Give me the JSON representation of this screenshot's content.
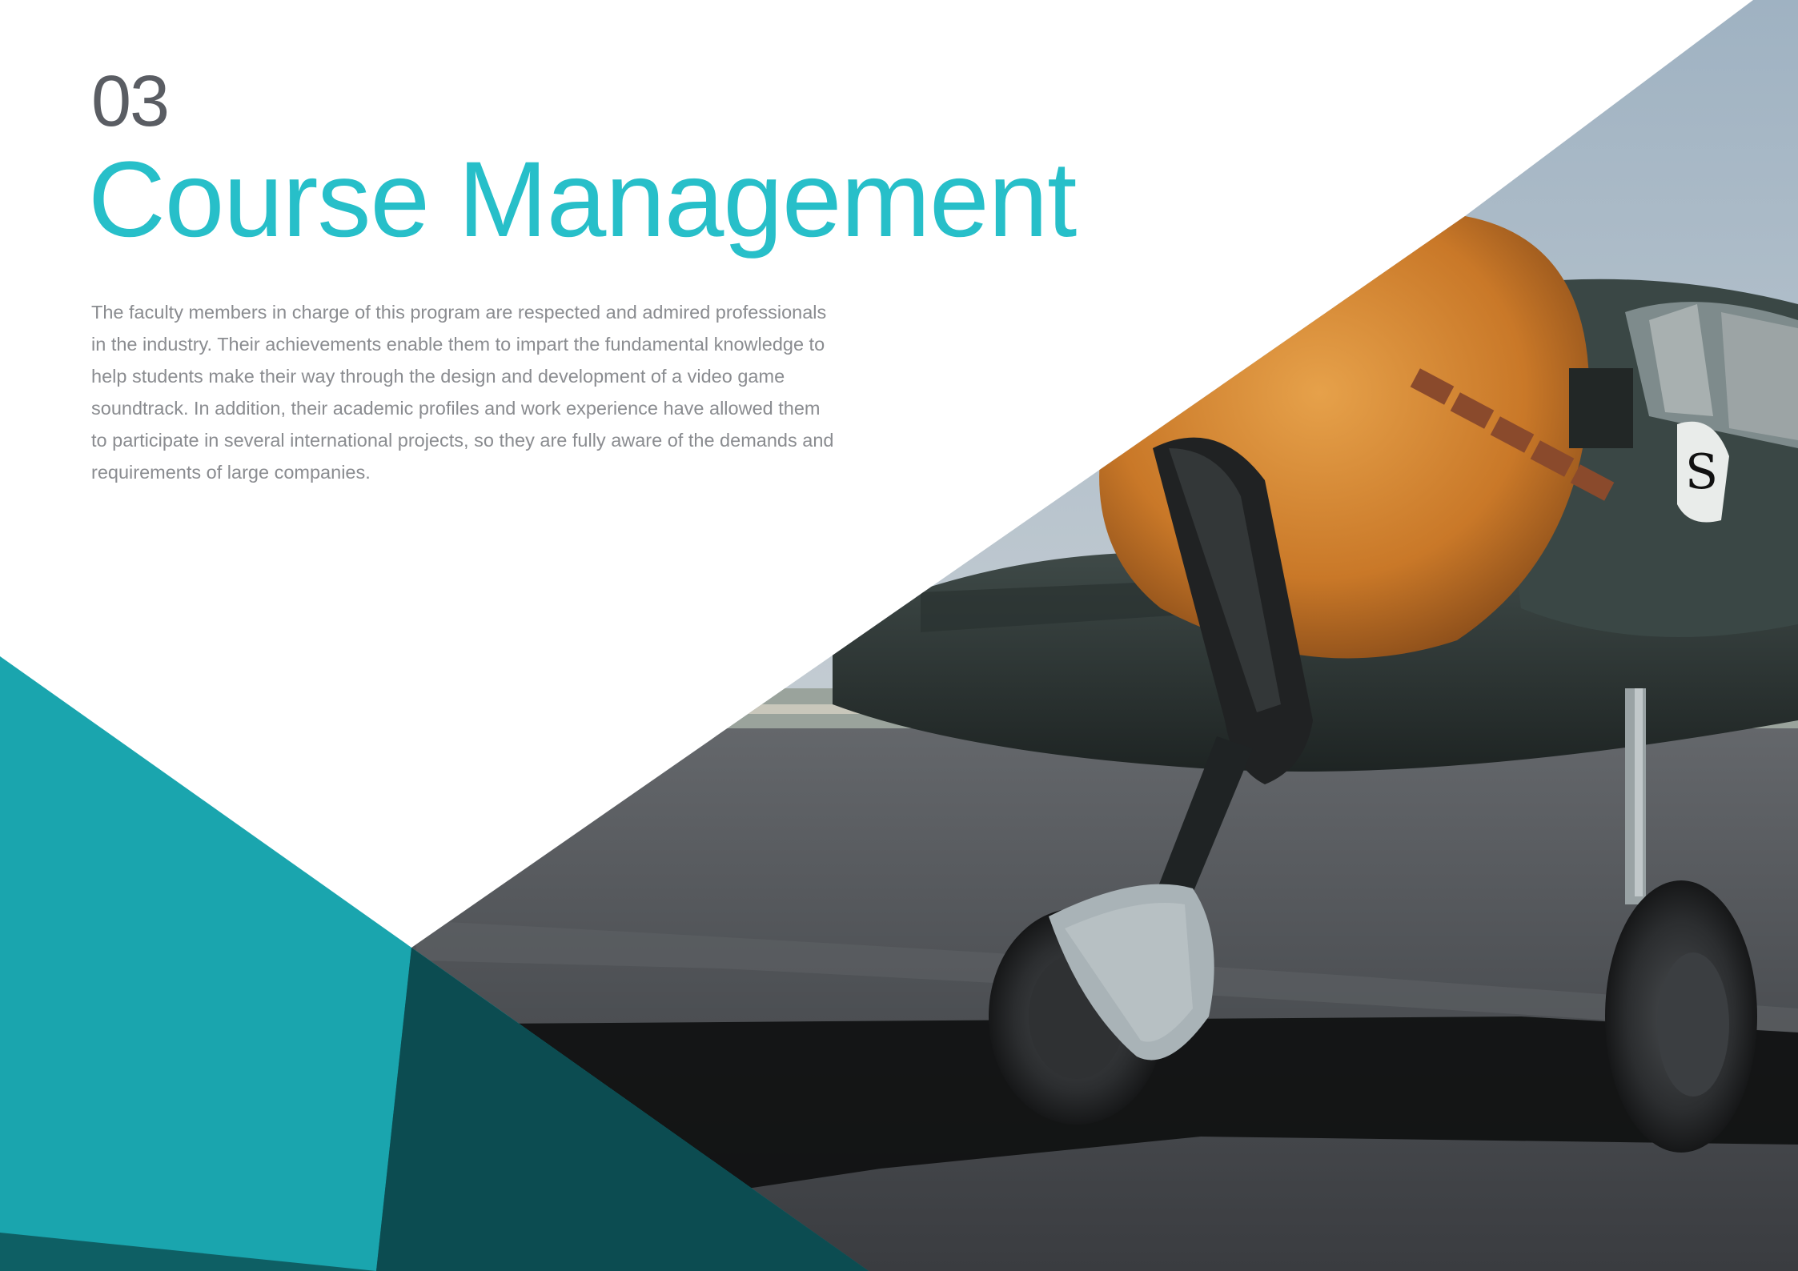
{
  "section": {
    "number": "03",
    "title": "Course Management",
    "body": "The faculty members in charge of this program are respected and admired professionals in the industry. Their achievements enable them to impart the fundamental knowledge to help students make their way through the design and development of a video game soundtrack. In addition, their academic profiles and work experience have allowed them to participate in several international projects, so they are fully aware of the demands and requirements of large companies."
  },
  "theme": {
    "accent": "#27bfc9",
    "teal_shape": "#1aa5ae",
    "dark_teal_shape": "#0d5257",
    "number_color": "#5a5d63",
    "body_color": "#8a8c90"
  },
  "image": {
    "subject": "propeller-airplane-on-runway"
  }
}
